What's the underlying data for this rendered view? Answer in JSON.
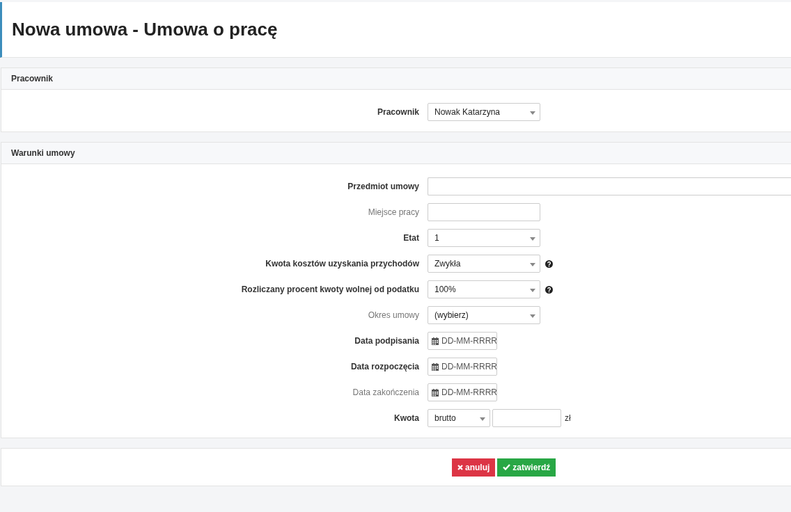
{
  "page_title": "Nowa umowa - Umowa o pracę",
  "sections": [
    {
      "title": "Pracownik",
      "fields": [
        {
          "label": "Pracownik",
          "required": true,
          "kind": "select",
          "value": "Nowak Katarzyna",
          "help": false
        }
      ]
    },
    {
      "title": "Warunki umowy",
      "fields": [
        {
          "label": "Przedmiot umowy",
          "required": true,
          "kind": "text-wide",
          "help": false
        },
        {
          "label": "Miejsce pracy",
          "required": false,
          "kind": "text",
          "help": false
        },
        {
          "label": "Etat",
          "required": true,
          "kind": "select",
          "value": "1",
          "help": false
        },
        {
          "label": "Kwota kosztów uzyskania przychodów",
          "required": true,
          "kind": "select",
          "value": "Zwykła",
          "help": true
        },
        {
          "label": "Rozliczany procent kwoty wolnej od podatku",
          "required": true,
          "kind": "select",
          "value": "100%",
          "help": true
        },
        {
          "label": "Okres umowy",
          "required": false,
          "kind": "select",
          "value": "(wybierz)",
          "help": false
        },
        {
          "label": "Data podpisania",
          "required": true,
          "kind": "date",
          "placeholder": "DD-MM-RRRR",
          "help": false
        },
        {
          "label": "Data rozpoczęcia",
          "required": true,
          "kind": "date",
          "placeholder": "DD-MM-RRRR",
          "help": false
        },
        {
          "label": "Data zakończenia",
          "required": false,
          "kind": "date",
          "placeholder": "DD-MM-RRRR",
          "help": false
        },
        {
          "label": "Kwota",
          "required": true,
          "kind": "amount",
          "value": "brutto",
          "suffix": "zł",
          "help": false
        }
      ]
    }
  ],
  "buttons": [
    {
      "kind": "cancel",
      "label": "anuluj"
    },
    {
      "kind": "confirm",
      "label": "zatwierdź"
    }
  ]
}
